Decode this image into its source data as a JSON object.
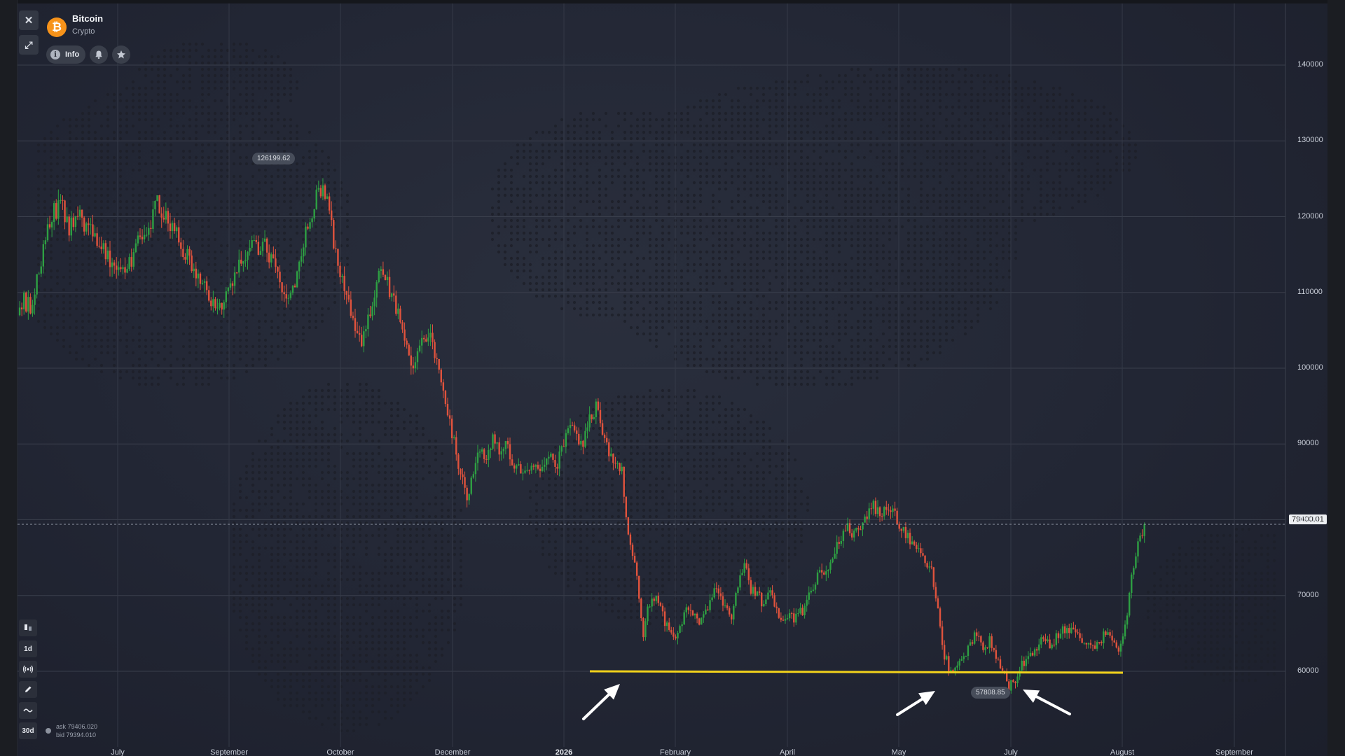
{
  "asset": {
    "name": "Bitcoin",
    "category": "Crypto",
    "logo_symbol": "₿"
  },
  "header_controls": {
    "close_glyph": "✕",
    "expand_glyph": "⤢",
    "info_label": "Info",
    "info_glyph": "i"
  },
  "icons": [
    "close-icon",
    "expand-icon",
    "info-icon",
    "bell-icon",
    "star-icon",
    "candles-icon",
    "signal-icon",
    "pencil-icon",
    "wave-icon"
  ],
  "toolbar": {
    "timeframe_label": "1d",
    "range_label": "30d"
  },
  "quote": {
    "ask": "ask 79406.020",
    "bid": "bid 79394.010"
  },
  "price_labels": {
    "current": "79400.01",
    "high": "126199.62",
    "low": "57808.85"
  },
  "colors": {
    "up": "#2ea043",
    "down": "#e0533d",
    "support_line": "#f2d21b",
    "arrows": "#ffffff"
  },
  "chart_data": {
    "type": "candlestick",
    "title": "",
    "xlabel": "",
    "ylabel": "",
    "y_ticks": [
      60000,
      70000,
      80000,
      90000,
      100000,
      110000,
      120000,
      130000,
      140000
    ],
    "ylim": [
      51000,
      148000
    ],
    "x_tick_labels": [
      "July",
      "September",
      "October",
      "December",
      "2026",
      "February",
      "April",
      "May",
      "July",
      "August",
      "September"
    ],
    "current_price": 79400.01,
    "annotated_high": 126199.62,
    "annotated_low": 57808.85,
    "support_level": 60000,
    "grid": true,
    "price_path": [
      [
        0,
        107000
      ],
      [
        3,
        109000
      ],
      [
        6,
        108000
      ],
      [
        9,
        112000
      ],
      [
        12,
        116000
      ],
      [
        16,
        120000
      ],
      [
        20,
        122000
      ],
      [
        24,
        118000
      ],
      [
        28,
        121000
      ],
      [
        33,
        118000
      ],
      [
        38,
        117000
      ],
      [
        44,
        114000
      ],
      [
        50,
        112000
      ],
      [
        55,
        116000
      ],
      [
        60,
        118000
      ],
      [
        65,
        122000
      ],
      [
        70,
        120000
      ],
      [
        76,
        116000
      ],
      [
        82,
        113000
      ],
      [
        88,
        110000
      ],
      [
        93,
        108000
      ],
      [
        99,
        110000
      ],
      [
        104,
        114000
      ],
      [
        110,
        116000
      ],
      [
        116,
        116000
      ],
      [
        121,
        112000
      ],
      [
        126,
        109000
      ],
      [
        130,
        112000
      ],
      [
        134,
        118000
      ],
      [
        138,
        122000
      ],
      [
        142,
        124000
      ],
      [
        145,
        121000
      ],
      [
        148,
        115000
      ],
      [
        152,
        110000
      ],
      [
        156,
        106000
      ],
      [
        160,
        104000
      ],
      [
        164,
        108000
      ],
      [
        168,
        113000
      ],
      [
        172,
        111000
      ],
      [
        176,
        108000
      ],
      [
        180,
        103000
      ],
      [
        184,
        100000
      ],
      [
        188,
        103000
      ],
      [
        191,
        105000
      ],
      [
        194,
        102000
      ],
      [
        197,
        98000
      ],
      [
        200,
        94000
      ],
      [
        203,
        90000
      ],
      [
        206,
        86000
      ],
      [
        209,
        83000
      ],
      [
        212,
        86000
      ],
      [
        215,
        89000
      ],
      [
        218,
        88000
      ],
      [
        221,
        91000
      ],
      [
        224,
        89000
      ],
      [
        227,
        90000
      ],
      [
        230,
        88000
      ],
      [
        233,
        87000
      ],
      [
        236,
        86000
      ],
      [
        239,
        87000
      ],
      [
        242,
        87000
      ],
      [
        245,
        87500
      ],
      [
        248,
        88000
      ],
      [
        251,
        87500
      ],
      [
        254,
        90000
      ],
      [
        257,
        92000
      ],
      [
        260,
        91000
      ],
      [
        263,
        90000
      ],
      [
        266,
        93000
      ],
      [
        269,
        95000
      ],
      [
        272,
        92000
      ],
      [
        275,
        89000
      ],
      [
        278,
        88000
      ],
      [
        281,
        87000
      ],
      [
        283,
        80000
      ],
      [
        285,
        77000
      ],
      [
        287,
        74000
      ],
      [
        289,
        70000
      ],
      [
        291,
        65000
      ],
      [
        293,
        68000
      ],
      [
        296,
        70000
      ],
      [
        299,
        68000
      ],
      [
        302,
        66000
      ],
      [
        305,
        64000
      ],
      [
        308,
        66000
      ],
      [
        311,
        68000
      ],
      [
        314,
        68000
      ],
      [
        317,
        66000
      ],
      [
        320,
        68000
      ],
      [
        323,
        70000
      ],
      [
        326,
        71000
      ],
      [
        329,
        68000
      ],
      [
        332,
        67000
      ],
      [
        335,
        71000
      ],
      [
        338,
        74000
      ],
      [
        341,
        71000
      ],
      [
        344,
        70000
      ],
      [
        347,
        69000
      ],
      [
        350,
        70000
      ],
      [
        353,
        68000
      ],
      [
        356,
        66000
      ],
      [
        359,
        67000
      ],
      [
        362,
        67000
      ],
      [
        365,
        68000
      ],
      [
        368,
        70000
      ],
      [
        371,
        72000
      ],
      [
        374,
        73000
      ],
      [
        377,
        74000
      ],
      [
        380,
        76000
      ],
      [
        383,
        78000
      ],
      [
        386,
        79000
      ],
      [
        389,
        78000
      ],
      [
        392,
        79000
      ],
      [
        395,
        80000
      ],
      [
        398,
        82000
      ],
      [
        401,
        81000
      ],
      [
        404,
        82000
      ],
      [
        407,
        81000
      ],
      [
        410,
        79000
      ],
      [
        413,
        78000
      ],
      [
        416,
        77000
      ],
      [
        419,
        76000
      ],
      [
        422,
        74000
      ],
      [
        425,
        73000
      ],
      [
        428,
        68000
      ],
      [
        431,
        62000
      ],
      [
        434,
        60000
      ],
      [
        437,
        61000
      ],
      [
        440,
        62000
      ],
      [
        443,
        64000
      ],
      [
        446,
        65000
      ],
      [
        449,
        63000
      ],
      [
        452,
        64000
      ],
      [
        455,
        62000
      ],
      [
        458,
        60000
      ],
      [
        461,
        58000
      ],
      [
        464,
        59000
      ],
      [
        467,
        61000
      ],
      [
        470,
        62000
      ],
      [
        473,
        63000
      ],
      [
        476,
        64000
      ],
      [
        479,
        63500
      ],
      [
        482,
        64000
      ],
      [
        485,
        65000
      ],
      [
        488,
        66000
      ],
      [
        491,
        65000
      ],
      [
        494,
        64500
      ],
      [
        497,
        64000
      ],
      [
        500,
        63500
      ],
      [
        503,
        64000
      ],
      [
        506,
        65000
      ],
      [
        509,
        64000
      ],
      [
        512,
        63000
      ],
      [
        514,
        64000
      ],
      [
        516,
        68000
      ],
      [
        518,
        72000
      ],
      [
        520,
        76000
      ],
      [
        522,
        78000
      ],
      [
        524,
        79400
      ]
    ]
  }
}
